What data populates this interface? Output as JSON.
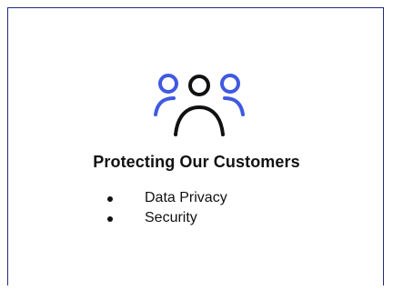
{
  "title": "Protecting Our Customers",
  "items": [
    {
      "label": "Data Privacy"
    },
    {
      "label": "Security"
    }
  ],
  "icon": {
    "name": "users-group-icon",
    "accent_color": "#3f5ae0",
    "main_color": "#111111"
  }
}
